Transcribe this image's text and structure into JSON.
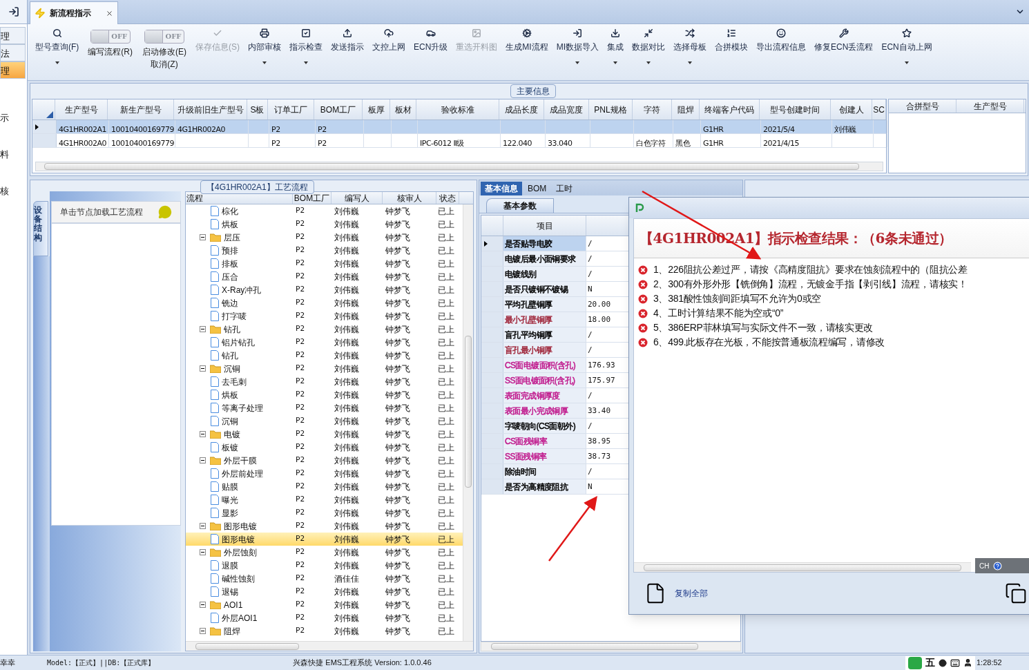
{
  "tab_bar": {
    "tabs": [
      {
        "label": "新流程指示",
        "selected": true
      }
    ]
  },
  "sidebar": {
    "items": [
      {
        "label": "理",
        "kind": "button",
        "selected": false
      },
      {
        "label": "法",
        "kind": "button",
        "selected": false
      },
      {
        "label": "理",
        "kind": "button",
        "selected": true
      },
      {
        "label": "示",
        "kind": "text",
        "selected": false
      },
      {
        "label": "料",
        "kind": "text",
        "selected": false
      },
      {
        "label": "核",
        "kind": "text",
        "selected": false
      }
    ]
  },
  "ribbon": {
    "items": [
      {
        "kind": "button",
        "label": "型号查询(F)",
        "disabled": false,
        "dropdown": true
      },
      {
        "kind": "toggle",
        "label": "编写流程(R)",
        "on": false,
        "state": "OFF"
      },
      {
        "kind": "toggle",
        "label": "启动修改(E)",
        "sublabel": "取消(Z)",
        "on": false,
        "state": "OFF"
      },
      {
        "kind": "button",
        "label": "保存信息(S)",
        "disabled": true,
        "dropdown": false
      },
      {
        "kind": "button",
        "label": "内部审核",
        "disabled": false,
        "dropdown": true
      },
      {
        "kind": "button",
        "label": "指示检查",
        "disabled": false,
        "dropdown": true
      },
      {
        "kind": "button",
        "label": "发送指示",
        "disabled": false,
        "dropdown": false
      },
      {
        "kind": "button",
        "label": "文控上网",
        "disabled": false,
        "dropdown": false
      },
      {
        "kind": "button",
        "label": "ECN升级",
        "disabled": false,
        "dropdown": false
      },
      {
        "kind": "button",
        "label": "重选开料图",
        "disabled": true,
        "dropdown": false
      },
      {
        "kind": "button",
        "label": "生成MI流程",
        "disabled": false,
        "dropdown": false
      },
      {
        "kind": "button",
        "label": "MI数据导入",
        "disabled": false,
        "dropdown": true
      },
      {
        "kind": "button",
        "label": "集成",
        "disabled": false,
        "dropdown": true
      },
      {
        "kind": "button",
        "label": "数据对比",
        "disabled": false,
        "dropdown": true
      },
      {
        "kind": "button",
        "label": "选择母板",
        "disabled": false,
        "dropdown": true
      },
      {
        "kind": "button",
        "label": "合拼模块",
        "disabled": false,
        "dropdown": false
      },
      {
        "kind": "button",
        "label": "导出流程信息",
        "disabled": false,
        "dropdown": false
      },
      {
        "kind": "button",
        "label": "修复ECN丢流程",
        "disabled": false,
        "dropdown": false
      },
      {
        "kind": "button",
        "label": "ECN自动上网",
        "disabled": false,
        "dropdown": true
      }
    ]
  },
  "main_info": {
    "title": "主要信息",
    "columns": [
      "生产型号",
      "新生产型号",
      "升级前旧生产型号",
      "S板",
      "订单工厂",
      "BOM工厂",
      "板厚",
      "板材",
      "验收标准",
      "成品长度",
      "成品宽度",
      "PNL规格",
      "字符",
      "阻焊",
      "终端客户代码",
      "型号创建时间",
      "创建人",
      "SC"
    ],
    "rows": [
      {
        "selected": true,
        "cells": [
          "4G1HR002A1",
          "10010400169779",
          "4G1HR002A0",
          null,
          "P2",
          "P2",
          null,
          null,
          null,
          null,
          null,
          null,
          null,
          null,
          "G1HR",
          "2021/5/4",
          "刘伟巍",
          null
        ]
      },
      {
        "selected": false,
        "cells": [
          "4G1HR002A0",
          "10010400169779",
          null,
          null,
          "P2",
          "P2",
          null,
          null,
          "IPC-6012 Ⅱ级",
          "122.040",
          "33.040",
          null,
          "白色字符",
          "黑色",
          "G1HR",
          "2021/4/15",
          null,
          null
        ]
      }
    ],
    "side_columns": [
      "合拼型号",
      "生产型号"
    ]
  },
  "process": {
    "title": "【4G1HR002A1】工艺流程",
    "side_tab": "设备结构",
    "hint": "单击节点加载工艺流程",
    "columns": [
      "流程",
      "BOM工厂",
      "编写人",
      "核审人",
      "状态"
    ],
    "rows": [
      {
        "children": [
          {
            "label": "棕化",
            "kind": "step",
            "selected": false,
            "bom": "P2",
            "writer": "刘伟巍",
            "reviewer": "钟梦飞",
            "status": "已上"
          },
          {
            "label": "烘板",
            "kind": "step",
            "selected": false,
            "bom": "P2",
            "writer": "刘伟巍",
            "reviewer": "钟梦飞",
            "status": "已上"
          }
        ]
      },
      {
        "label": "层压",
        "kind": "folder",
        "expanded": true,
        "selected": false,
        "bom": "P2",
        "writer": "刘伟巍",
        "reviewer": "钟梦飞",
        "status": "已上",
        "children": [
          {
            "label": "预排",
            "kind": "step",
            "selected": false,
            "bom": "P2",
            "writer": "刘伟巍",
            "reviewer": "钟梦飞",
            "status": "已上"
          },
          {
            "label": "排板",
            "kind": "step",
            "selected": false,
            "bom": "P2",
            "writer": "刘伟巍",
            "reviewer": "钟梦飞",
            "status": "已上"
          },
          {
            "label": "压合",
            "kind": "step",
            "selected": false,
            "bom": "P2",
            "writer": "刘伟巍",
            "reviewer": "钟梦飞",
            "status": "已上"
          },
          {
            "label": "X-Ray冲孔",
            "kind": "step",
            "selected": false,
            "bom": "P2",
            "writer": "刘伟巍",
            "reviewer": "钟梦飞",
            "status": "已上"
          },
          {
            "label": "铣边",
            "kind": "step",
            "selected": false,
            "bom": "P2",
            "writer": "刘伟巍",
            "reviewer": "钟梦飞",
            "status": "已上"
          },
          {
            "label": "打字唛",
            "kind": "step",
            "selected": false,
            "bom": "P2",
            "writer": "刘伟巍",
            "reviewer": "钟梦飞",
            "status": "已上"
          }
        ]
      },
      {
        "label": "钻孔",
        "kind": "folder",
        "expanded": true,
        "selected": false,
        "bom": "P2",
        "writer": "刘伟巍",
        "reviewer": "钟梦飞",
        "status": "已上",
        "children": [
          {
            "label": "铝片钻孔",
            "kind": "step",
            "selected": false,
            "bom": "P2",
            "writer": "刘伟巍",
            "reviewer": "钟梦飞",
            "status": "已上"
          },
          {
            "label": "钻孔",
            "kind": "step",
            "selected": false,
            "bom": "P2",
            "writer": "刘伟巍",
            "reviewer": "钟梦飞",
            "status": "已上"
          }
        ]
      },
      {
        "label": "沉铜",
        "kind": "folder",
        "expanded": true,
        "selected": false,
        "bom": "P2",
        "writer": "刘伟巍",
        "reviewer": "钟梦飞",
        "status": "已上",
        "children": [
          {
            "label": "去毛刺",
            "kind": "step",
            "selected": false,
            "bom": "P2",
            "writer": "刘伟巍",
            "reviewer": "钟梦飞",
            "status": "已上"
          },
          {
            "label": "烘板",
            "kind": "step",
            "selected": false,
            "bom": "P2",
            "writer": "刘伟巍",
            "reviewer": "钟梦飞",
            "status": "已上"
          },
          {
            "label": "等离子处理",
            "kind": "step",
            "selected": false,
            "bom": "P2",
            "writer": "刘伟巍",
            "reviewer": "钟梦飞",
            "status": "已上"
          },
          {
            "label": "沉铜",
            "kind": "step",
            "selected": false,
            "bom": "P2",
            "writer": "刘伟巍",
            "reviewer": "钟梦飞",
            "status": "已上"
          }
        ]
      },
      {
        "label": "电镀",
        "kind": "folder",
        "expanded": true,
        "selected": false,
        "bom": "P2",
        "writer": "刘伟巍",
        "reviewer": "钟梦飞",
        "status": "已上",
        "children": [
          {
            "label": "板镀",
            "kind": "step",
            "selected": false,
            "bom": "P2",
            "writer": "刘伟巍",
            "reviewer": "钟梦飞",
            "status": "已上"
          }
        ]
      },
      {
        "label": "外层干膜",
        "kind": "folder",
        "expanded": true,
        "selected": false,
        "bom": "P2",
        "writer": "刘伟巍",
        "reviewer": "钟梦飞",
        "status": "已上",
        "children": [
          {
            "label": "外层前处理",
            "kind": "step",
            "selected": false,
            "bom": "P2",
            "writer": "刘伟巍",
            "reviewer": "钟梦飞",
            "status": "已上"
          },
          {
            "label": "贴膜",
            "kind": "step",
            "selected": false,
            "bom": "P2",
            "writer": "刘伟巍",
            "reviewer": "钟梦飞",
            "status": "已上"
          },
          {
            "label": "曝光",
            "kind": "step",
            "selected": false,
            "bom": "P2",
            "writer": "刘伟巍",
            "reviewer": "钟梦飞",
            "status": "已上"
          },
          {
            "label": "显影",
            "kind": "step",
            "selected": false,
            "bom": "P2",
            "writer": "刘伟巍",
            "reviewer": "钟梦飞",
            "status": "已上"
          }
        ]
      },
      {
        "label": "图形电镀",
        "kind": "folder",
        "expanded": true,
        "selected": false,
        "bom": "P2",
        "writer": "刘伟巍",
        "reviewer": "钟梦飞",
        "status": "已上",
        "children": [
          {
            "label": "图形电镀",
            "kind": "step",
            "selected": true,
            "bom": "P2",
            "writer": "刘伟巍",
            "reviewer": "钟梦飞",
            "status": "已上"
          }
        ]
      },
      {
        "label": "外层蚀刻",
        "kind": "folder",
        "expanded": true,
        "selected": false,
        "bom": "P2",
        "writer": "刘伟巍",
        "reviewer": "钟梦飞",
        "status": "已上",
        "children": [
          {
            "label": "退膜",
            "kind": "step",
            "selected": false,
            "bom": "P2",
            "writer": "刘伟巍",
            "reviewer": "钟梦飞",
            "status": "已上"
          },
          {
            "label": "碱性蚀刻",
            "kind": "step",
            "selected": false,
            "bom": "P2",
            "writer": "酒佳佳",
            "reviewer": "钟梦飞",
            "status": "已上"
          },
          {
            "label": "退锡",
            "kind": "step",
            "selected": false,
            "bom": "P2",
            "writer": "刘伟巍",
            "reviewer": "钟梦飞",
            "status": "已上"
          }
        ]
      },
      {
        "label": "AOI1",
        "kind": "folder",
        "expanded": true,
        "selected": false,
        "bom": "P2",
        "writer": "刘伟巍",
        "reviewer": "钟梦飞",
        "status": "已上",
        "children": [
          {
            "label": "外层AOI1",
            "kind": "step",
            "selected": false,
            "bom": "P2",
            "writer": "刘伟巍",
            "reviewer": "钟梦飞",
            "status": "已上"
          }
        ]
      },
      {
        "label": "阻焊",
        "kind": "folder",
        "expanded": true,
        "selected": false,
        "bom": "P2",
        "writer": "刘伟巍",
        "reviewer": "钟梦飞",
        "status": "已上"
      }
    ]
  },
  "detail": {
    "tabs": [
      {
        "label": "基本信息",
        "selected": true
      },
      {
        "label": "BOM",
        "selected": false
      },
      {
        "label": "工时",
        "selected": false
      }
    ],
    "sub_tab": "基本参数",
    "column": "项目",
    "rows": [
      {
        "label": "是否贴导电胶",
        "value": "/",
        "color": "#000000",
        "selected": true
      },
      {
        "label": "电镀后最小面铜要求",
        "value": "/",
        "color": "#000000",
        "selected": false
      },
      {
        "label": "电镀线别",
        "value": "/",
        "color": "#000000",
        "selected": false
      },
      {
        "label": "是否只镀铜不镀锡",
        "value": "N",
        "color": "#000000",
        "selected": false
      },
      {
        "label": "平均孔壁铜厚",
        "value": "20.00",
        "color": "#000000",
        "selected": false
      },
      {
        "label": "最小孔壁铜厚",
        "value": "18.00",
        "color": "#a0283c",
        "selected": false
      },
      {
        "label": "盲孔平均铜厚",
        "value": "/",
        "color": "#000000",
        "selected": false
      },
      {
        "label": "盲孔最小铜厚",
        "value": "/",
        "color": "#a0283c",
        "selected": false
      },
      {
        "label": "CS面电镀面积(含孔)",
        "value": "176.93",
        "color": "#c0188c",
        "selected": false
      },
      {
        "label": "SS面电镀面积(含孔)",
        "value": "175.97",
        "color": "#c0188c",
        "selected": false
      },
      {
        "label": "表面完成铜厚度",
        "value": "/",
        "color": "#c0188c",
        "selected": false
      },
      {
        "label": "表面最小完成铜厚",
        "value": "33.40",
        "color": "#c0188c",
        "selected": false
      },
      {
        "label": "字唛朝向(CS面朝外)",
        "value": "/",
        "color": "#000000",
        "selected": false
      },
      {
        "label": "CS面残铜率",
        "value": "38.95",
        "color": "#c0188c",
        "selected": false
      },
      {
        "label": "SS面残铜率",
        "value": "38.73",
        "color": "#c0188c",
        "selected": false
      },
      {
        "label": "除油时间",
        "value": "/",
        "color": "#000000",
        "selected": false
      },
      {
        "label": "是否为高精度阻抗",
        "value": "N",
        "color": "#000000",
        "selected": false
      }
    ]
  },
  "dialog": {
    "heading": "【4G1HR002A1】指示检查结果：（6条未通过）",
    "messages": [
      "1、226阻抗公差过严，请按《高精度阻抗》要求在蚀刻流程中的（阻抗公差",
      "2、300有外形外形【铣倒角】流程，无镀金手指【剥引线】流程，请核实！",
      "3、381酸性蚀刻间距填写不允许为0或空",
      "4、工时计算结果不能为空或“0”",
      "5、386ERP菲林填写与实际文件不一致，请核实更改",
      "6、499.此板存在光板，不能按普通板流程编写，请修改"
    ],
    "copy_link": "复制全部"
  },
  "ime": {
    "label": "CH",
    "tray": "五"
  },
  "status_bar": {
    "left": "幸幸",
    "model": "Model:【正式】||DB:【正式库】",
    "app": "兴森快捷 EMS工程系统 Version: 1.0.0.46",
    "time": "1:28:52"
  }
}
